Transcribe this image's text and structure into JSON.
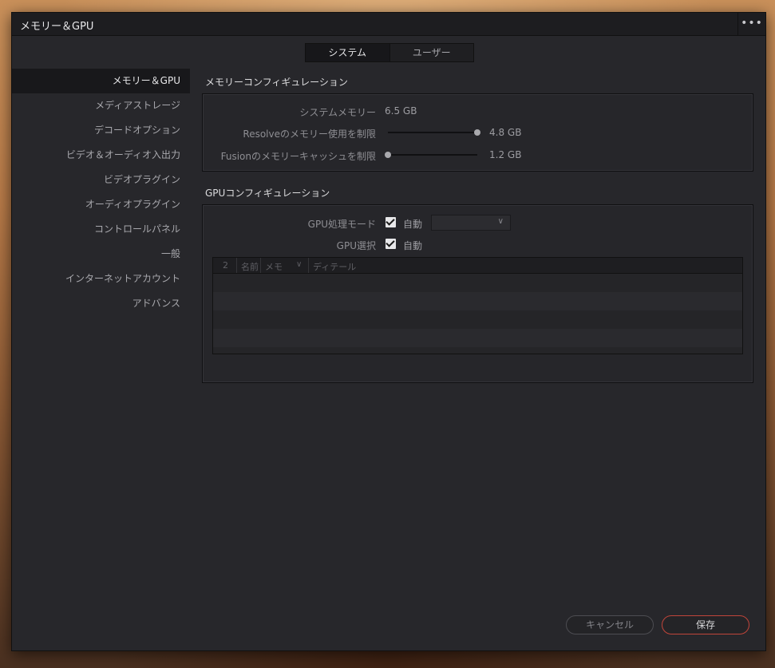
{
  "window": {
    "title": "メモリー＆GPU",
    "menu_icon": "more-icon",
    "menu_glyph": "•••"
  },
  "tabs": [
    {
      "label": "システム",
      "active": true
    },
    {
      "label": "ユーザー",
      "active": false
    }
  ],
  "sidebar": {
    "items": [
      {
        "label": "メモリー＆GPU",
        "active": true
      },
      {
        "label": "メディアストレージ"
      },
      {
        "label": "デコードオプション"
      },
      {
        "label": "ビデオ＆オーディオ入出力"
      },
      {
        "label": "ビデオプラグイン"
      },
      {
        "label": "オーディオプラグイン"
      },
      {
        "label": "コントロールパネル"
      },
      {
        "label": "一般"
      },
      {
        "label": "インターネットアカウント"
      },
      {
        "label": "アドバンス"
      }
    ]
  },
  "memory": {
    "section_title": "メモリーコンフィギュレーション",
    "system_memory_label": "システムメモリー",
    "system_memory_value": "6.5 GB",
    "resolve_limit_label": "Resolveのメモリー使用を制限",
    "resolve_limit_value": "4.8 GB",
    "resolve_limit_fraction": 1.0,
    "fusion_cache_label": "Fusionのメモリーキャッシュを制限",
    "fusion_cache_value": "1.2 GB",
    "fusion_cache_fraction": 0.0
  },
  "gpu": {
    "section_title": "GPUコンフィギュレーション",
    "mode_label": "GPU処理モード",
    "mode_auto_label": "自動",
    "mode_auto_checked": true,
    "mode_combo_value": "",
    "select_label": "GPU選択",
    "select_auto_label": "自動",
    "select_auto_checked": true,
    "table": {
      "columns": [
        "2",
        "名前",
        "メモ",
        "ディテール"
      ],
      "rows": []
    }
  },
  "footer": {
    "cancel_label": "キャンセル",
    "save_label": "保存"
  },
  "colors": {
    "accent_save_border": "#c0453a",
    "window_bg": "#27272b"
  }
}
